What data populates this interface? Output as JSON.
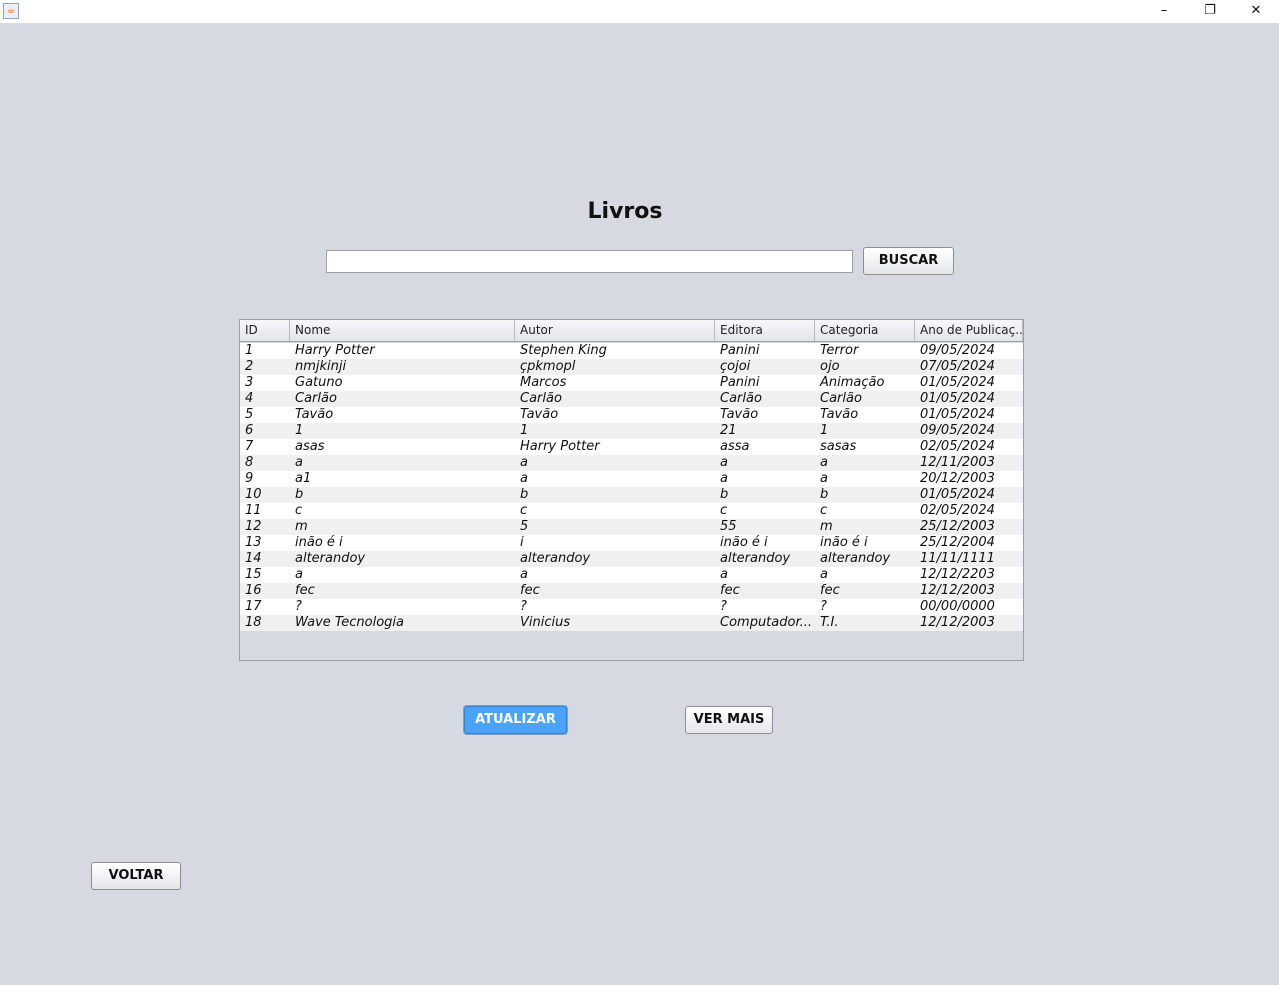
{
  "window": {
    "minimize": "–",
    "maximize": "❐",
    "close": "✕"
  },
  "title": "Livros",
  "search": {
    "value": "",
    "placeholder": ""
  },
  "buttons": {
    "buscar": "BUSCAR",
    "atualizar": "ATUALIZAR",
    "ver_mais": "VER MAIS",
    "voltar": "VOLTAR"
  },
  "table": {
    "columns": [
      "ID",
      "Nome",
      "Autor",
      "Editora",
      "Categoria",
      "Ano de Publicaç..."
    ],
    "rows": [
      [
        "1",
        "Harry Potter",
        "Stephen King",
        "Panini",
        "Terror",
        "09/05/2024"
      ],
      [
        "2",
        "nmjkinji",
        "çpkmopl",
        "çojoi",
        "ojo",
        "07/05/2024"
      ],
      [
        "3",
        "Gatuno",
        "Marcos",
        "Panini",
        "Animação",
        "01/05/2024"
      ],
      [
        "4",
        "Carlão",
        "Carlão",
        "Carlão",
        "Carlão",
        "01/05/2024"
      ],
      [
        "5",
        "Tavão",
        "Tavão",
        "Tavão",
        "Tavão",
        "01/05/2024"
      ],
      [
        "6",
        "1",
        "1",
        "21",
        "1",
        "09/05/2024"
      ],
      [
        "7",
        "asas",
        "Harry Potter",
        "assa",
        "sasas",
        "02/05/2024"
      ],
      [
        "8",
        "a",
        "a",
        "a",
        "a",
        "12/11/2003"
      ],
      [
        "9",
        "a1",
        "a",
        "a",
        "a",
        "20/12/2003"
      ],
      [
        "10",
        "b",
        "b",
        "b",
        "b",
        "01/05/2024"
      ],
      [
        "11",
        "c",
        "c",
        "c",
        "c",
        "02/05/2024"
      ],
      [
        "12",
        "m",
        "5",
        "55",
        "m",
        "25/12/2003"
      ],
      [
        "13",
        "inão é i",
        "i",
        "inão é i",
        "inão é i",
        "25/12/2004"
      ],
      [
        "14",
        "alterandoy",
        "alterandoy",
        "alterandoy",
        "alterandoy",
        "11/11/1111"
      ],
      [
        "15",
        "a",
        "a",
        "a",
        "a",
        "12/12/2203"
      ],
      [
        "16",
        "fec",
        "fec",
        "fec",
        "fec",
        "12/12/2003"
      ],
      [
        "17",
        "?",
        "?",
        "?",
        "?",
        "00/00/0000"
      ],
      [
        "18",
        "Wave Tecnologia",
        "Vinicius",
        "Computador...",
        "T.I.",
        "12/12/2003"
      ]
    ]
  }
}
